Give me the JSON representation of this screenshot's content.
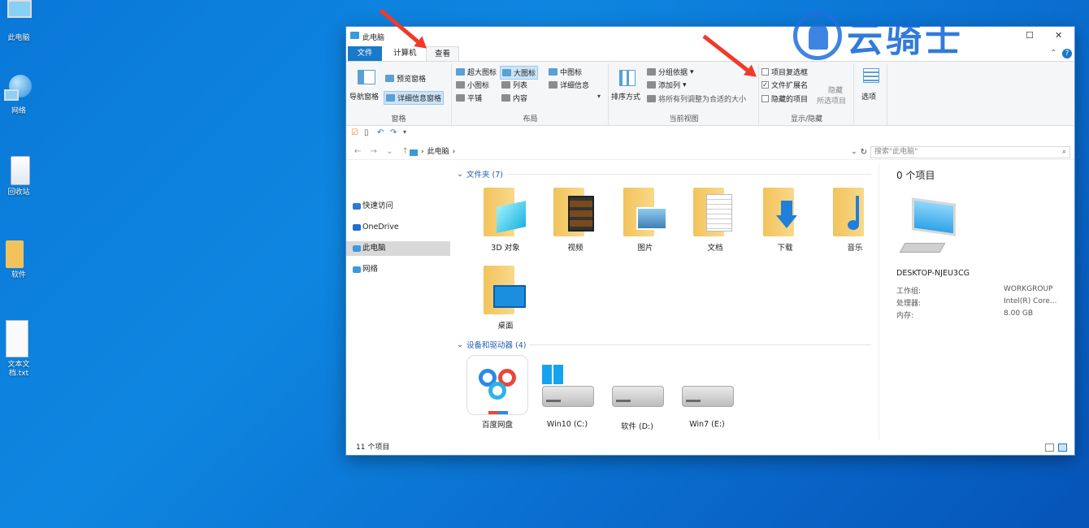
{
  "desktop": {
    "icons": [
      {
        "label": "此电脑",
        "icon": "computer-icon"
      },
      {
        "label": "网络",
        "icon": "network-icon"
      },
      {
        "label": "回收站",
        "icon": "recycle-bin-icon"
      },
      {
        "label": "软件",
        "icon": "folder-icon"
      },
      {
        "label": "文本文档.txt",
        "icon": "text-file-icon"
      }
    ]
  },
  "window": {
    "title": "此电脑",
    "controls": {
      "minimize": "─",
      "maximize": "☐",
      "close": "✕"
    },
    "tabs": [
      {
        "label": "文件"
      },
      {
        "label": "计算机"
      },
      {
        "label": "查看"
      }
    ],
    "ribbon": {
      "panes": {
        "nav_pane": "导航窗格",
        "preview": "预览窗格",
        "details": "详细信息窗格",
        "group_label": "窗格"
      },
      "layout": {
        "items": [
          "超大图标",
          "大图标",
          "中图标",
          "小图标",
          "列表",
          "详细信息",
          "平铺",
          "内容"
        ],
        "group_label": "布局"
      },
      "current_view": {
        "sort_by": "排序方式",
        "group_by": "分组依据",
        "add_column": "添加列",
        "fit_columns": "将所有列调整为合适的大小",
        "group_label": "当前视图"
      },
      "show_hide": {
        "item_checkboxes": "项目复选框",
        "file_extensions": "文件扩展名",
        "hidden_items": "隐藏的项目",
        "hide_selected": "隐藏",
        "hide_selected_2": "所选项目",
        "group_label": "显示/隐藏",
        "file_extensions_checked": true
      },
      "options": "选项"
    },
    "address": {
      "path": "此电脑",
      "search_placeholder": "搜索\"此电脑\""
    },
    "nav_pane": [
      {
        "label": "快速访问",
        "color": "#2a7bd4"
      },
      {
        "label": "OneDrive",
        "color": "#1e6fd0"
      },
      {
        "label": "此电脑",
        "color": "#3a9ad9"
      },
      {
        "label": "网络",
        "color": "#3a9ad9"
      }
    ],
    "content": {
      "folders_header": "文件夹 (7)",
      "folders": [
        "3D 对象",
        "视频",
        "图片",
        "文档",
        "下载",
        "音乐",
        "桌面"
      ],
      "devices_header": "设备和驱动器 (4)",
      "devices": [
        "百度网盘",
        "Win10 (C:)",
        "软件 (D:)",
        "Win7 (E:)"
      ]
    },
    "details": {
      "count": "0 个项目",
      "hostname": "DESKTOP-NJEU3CG",
      "rows": [
        {
          "key": "工作组:",
          "value": "WORKGROUP"
        },
        {
          "key": "处理器:",
          "value": "Intel(R) Core..."
        },
        {
          "key": "内存:",
          "value": "8.00 GB"
        }
      ]
    },
    "status": "11 个项目"
  },
  "watermark": "云骑士",
  "colors": {
    "accent": "#1979ca",
    "arrow": "#f03a2a",
    "desktop": "#0a78d8"
  }
}
